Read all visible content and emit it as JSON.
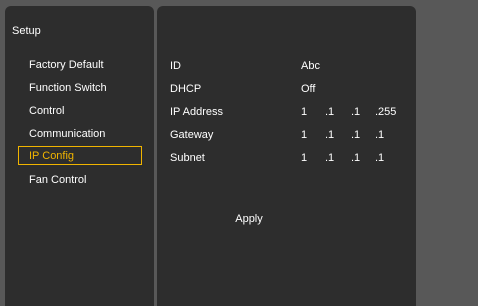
{
  "sidebar": {
    "title": "Setup",
    "items": [
      {
        "label": "Factory Default",
        "selected": false
      },
      {
        "label": "Function Switch",
        "selected": false
      },
      {
        "label": "Control",
        "selected": false
      },
      {
        "label": "Communication",
        "selected": false
      },
      {
        "label": "IP Config",
        "selected": true
      },
      {
        "label": "Fan Control",
        "selected": false
      }
    ]
  },
  "ip_config": {
    "id": {
      "label": "ID",
      "value": "Abc"
    },
    "dhcp": {
      "label": "DHCP",
      "value": "Off"
    },
    "ip_address": {
      "label": "IP Address",
      "octets": [
        "1",
        ".1",
        ".1",
        ".255"
      ]
    },
    "gateway": {
      "label": "Gateway",
      "octets": [
        "1",
        ".1",
        ".1",
        ".1"
      ]
    },
    "subnet": {
      "label": "Subnet",
      "octets": [
        "1",
        ".1",
        ".1",
        ".1"
      ]
    },
    "apply_label": "Apply"
  },
  "colors": {
    "background": "#585858",
    "panel": "#2d2d2d",
    "text": "#ffffff",
    "selected_accent": "#f0b400"
  }
}
